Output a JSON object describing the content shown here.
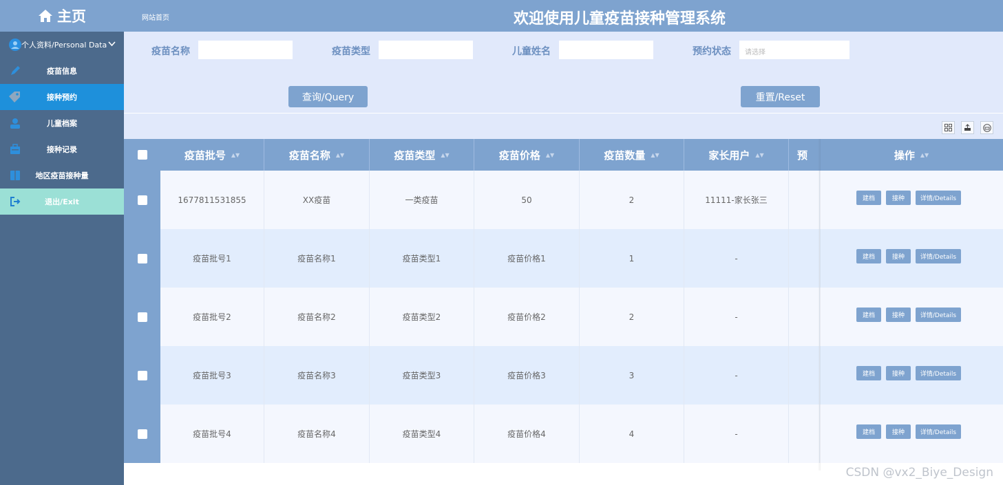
{
  "sidebar": {
    "home_label": "主页",
    "profile_label": "个人资料/Personal Data",
    "items": [
      {
        "label": "疫苗信息",
        "icon": "pen-icon"
      },
      {
        "label": "接种预约",
        "icon": "tag-icon",
        "active": true
      },
      {
        "label": "儿童档案",
        "icon": "person-card-icon"
      },
      {
        "label": "接种记录",
        "icon": "briefcase-icon"
      },
      {
        "label": "地区疫苗接种量",
        "icon": "book-icon"
      },
      {
        "label": "退出/Exit",
        "icon": "exit-icon"
      }
    ]
  },
  "header": {
    "breadcrumb": "网站首页",
    "title": "欢迎使用儿童疫苗接种管理系统"
  },
  "search": {
    "vaccine_name_label": "疫苗名称",
    "vaccine_type_label": "疫苗类型",
    "child_name_label": "儿童姓名",
    "status_label": "预约状态",
    "status_placeholder": "请选择",
    "query_button": "查询/Query",
    "reset_button": "重置/Reset"
  },
  "table": {
    "columns": [
      "疫苗批号",
      "疫苗名称",
      "疫苗类型",
      "疫苗价格",
      "疫苗数量",
      "家长用户",
      "预"
    ],
    "ops_header": "操作",
    "rows": [
      [
        "1677811531855",
        "XX疫苗",
        "一类疫苗",
        "50",
        "2",
        "11111-家长张三"
      ],
      [
        "疫苗批号1",
        "疫苗名称1",
        "疫苗类型1",
        "疫苗价格1",
        "1",
        "-"
      ],
      [
        "疫苗批号2",
        "疫苗名称2",
        "疫苗类型2",
        "疫苗价格2",
        "2",
        "-"
      ],
      [
        "疫苗批号3",
        "疫苗名称3",
        "疫苗类型3",
        "疫苗价格3",
        "3",
        "-"
      ],
      [
        "疫苗批号4",
        "疫苗名称4",
        "疫苗类型4",
        "疫苗价格4",
        "4",
        "-"
      ]
    ],
    "op_labels": [
      "建档",
      "接种",
      "详情/Details"
    ]
  },
  "watermark": "CSDN @vx2_Biye_Design"
}
